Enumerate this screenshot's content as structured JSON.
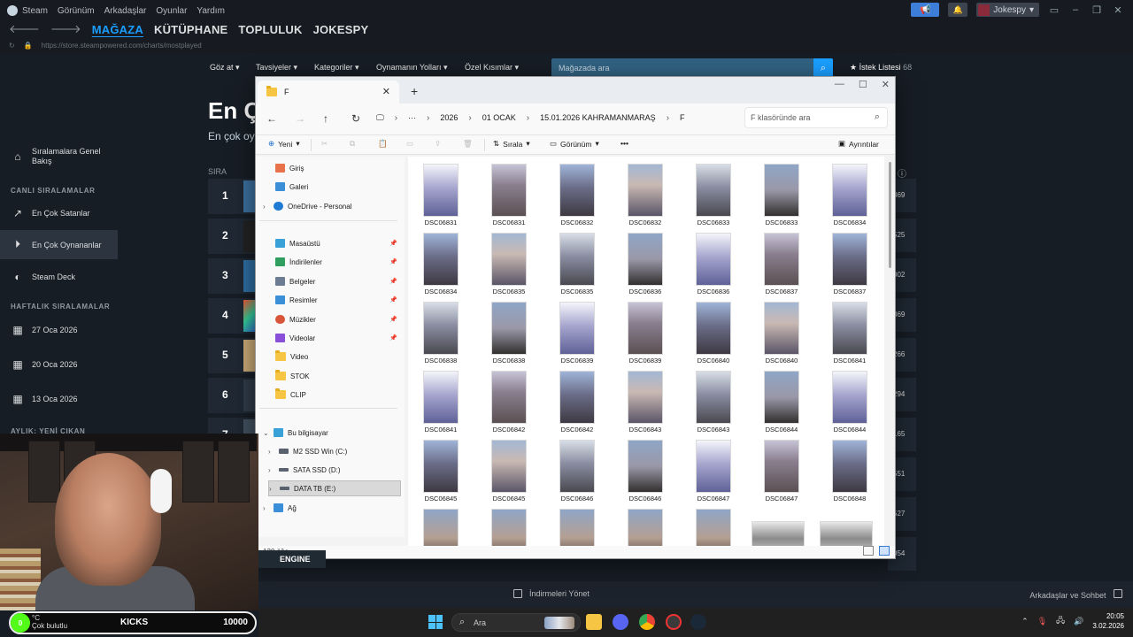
{
  "steam": {
    "menu": [
      "Steam",
      "Görünüm",
      "Arkadaşlar",
      "Oyunlar",
      "Yardım"
    ],
    "username": "Jokespy",
    "nav_tabs": [
      "MAĞAZA",
      "KÜTÜPHANE",
      "TOPLULUK",
      "JOKESPY"
    ],
    "url": "https://store.steampowered.com/charts/mostplayed",
    "store_nav": [
      "Göz at",
      "Tavsiyeler",
      "Kategoriler",
      "Oynamanın Yolları",
      "Özel Kısımlar"
    ],
    "search_placeholder": "Mağazada ara",
    "wishlist_label": "İstek Listesi",
    "wishlist_count": "68",
    "page_title": "En Ç",
    "page_subtitle": "En çok oy",
    "rank_header": "SIRA",
    "ranks": [
      "1",
      "2",
      "3",
      "4",
      "5",
      "6",
      "7"
    ],
    "right_values": [
      "369",
      "525",
      "002",
      "369",
      "266",
      "294",
      "165",
      "551",
      "527",
      "054"
    ],
    "sidebar": {
      "overview": "Sıralamalara Genel Bakış",
      "live_header": "CANLI SIRALAMALAR",
      "top_sellers": "En Çok Satanlar",
      "most_played": "En Çok Oynananlar",
      "steam_deck": "Steam Deck",
      "weekly_header": "HAFTALIK SIRALAMALAR",
      "weeks": [
        "27 Oca 2026",
        "20 Oca 2026",
        "13 Oca 2026"
      ],
      "monthly_header": "AYLIK: YENİ ÇIKAN"
    },
    "footer_downloads": "İndirmeleri Yönet",
    "footer_friends": "Arkadaşlar ve Sohbet"
  },
  "explorer": {
    "tab_title": "F",
    "breadcrumbs": [
      "2026",
      "01 OCAK",
      "15.01.2026 KAHRAMANMARAŞ",
      "F"
    ],
    "search_placeholder": "F klasöründe ara",
    "commands": {
      "new": "Yeni",
      "sort": "Sırala",
      "view": "Görünüm",
      "more": "•••",
      "details": "Ayrıntılar"
    },
    "nav_items": [
      {
        "label": "Giriş",
        "icon": "home-icon",
        "color": "#e8734a"
      },
      {
        "label": "Galeri",
        "icon": "gallery-icon",
        "color": "#3a8fd8"
      },
      {
        "label": "OneDrive - Personal",
        "icon": "cloud-icon",
        "color": "#1f7ad3"
      },
      {
        "label": "Masaüstü",
        "icon": "desktop-icon",
        "color": "#3aa0d8"
      },
      {
        "label": "İndirilenler",
        "icon": "download-icon",
        "color": "#2f9e5f"
      },
      {
        "label": "Belgeler",
        "icon": "documents-icon",
        "color": "#6b7c93"
      },
      {
        "label": "Resimler",
        "icon": "pictures-icon",
        "color": "#3a8fd8"
      },
      {
        "label": "Müzikler",
        "icon": "music-icon",
        "color": "#d8553a"
      },
      {
        "label": "Videolar",
        "icon": "videos-icon",
        "color": "#8a4fd8"
      },
      {
        "label": "Video",
        "icon": "folder-icon",
        "color": "#f5c543"
      },
      {
        "label": "STOK",
        "icon": "folder-icon",
        "color": "#f5c543"
      },
      {
        "label": "CLIP",
        "icon": "folder-icon",
        "color": "#f5c543"
      },
      {
        "label": "Bu bilgisayar",
        "icon": "pc-icon",
        "color": "#3aa0d8"
      },
      {
        "label": "M2 SSD Win (C:)",
        "icon": "drive-c-icon",
        "color": "#5a6270"
      },
      {
        "label": "SATA SSD (D:)",
        "icon": "drive-icon",
        "color": "#5a6270"
      },
      {
        "label": "DATA TB (E:)",
        "icon": "drive-icon",
        "color": "#5a6270"
      },
      {
        "label": "Ağ",
        "icon": "network-icon",
        "color": "#3a8fd8"
      }
    ],
    "files": [
      "DSC06831",
      "DSC06831",
      "DSC06832",
      "DSC06832",
      "DSC06833",
      "DSC06833",
      "DSC06834",
      "DSC06834",
      "DSC06835",
      "DSC06835",
      "DSC06836",
      "DSC06836",
      "DSC06837",
      "DSC06837",
      "DSC06838",
      "DSC06838",
      "DSC06839",
      "DSC06839",
      "DSC06840",
      "DSC06840",
      "DSC06841",
      "DSC06841",
      "DSC06842",
      "DSC06842",
      "DSC06843",
      "DSC06843",
      "DSC06844",
      "DSC06844",
      "DSC06845",
      "DSC06845",
      "DSC06846",
      "DSC06846",
      "DSC06847",
      "DSC06847",
      "DSC06848"
    ],
    "item_count": "130 öğe"
  },
  "overlay": {
    "kicks_label": "KICKS",
    "kicks_value": "10000",
    "kicks_badge": "0",
    "weather_temp": "°C",
    "weather_text": "Çok bulutlu",
    "engine_text": "ENGINE"
  },
  "taskbar": {
    "search_placeholder": "Ara",
    "time": "20:05",
    "date": "3.02.2026"
  },
  "colors": {
    "steam_accent": "#1a9fff",
    "steam_bg": "#171d25",
    "explorer_bg": "#f3f3f3",
    "kick_green": "#53fc18"
  }
}
